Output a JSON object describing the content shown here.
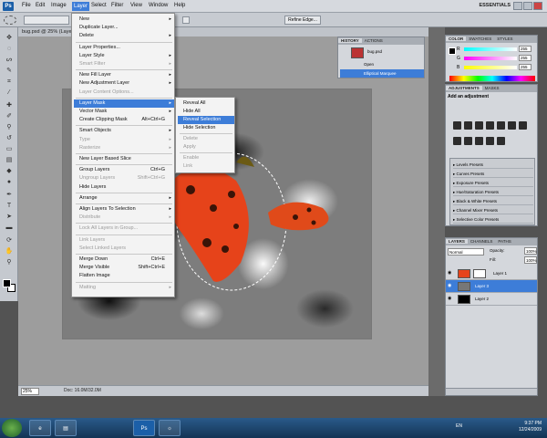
{
  "app": {
    "logo": "Ps",
    "workspace": "ESSENTIALS",
    "zoom_top": "25%"
  },
  "menubar": [
    "File",
    "Edit",
    "Image",
    "Layer",
    "Select",
    "Filter",
    "View",
    "Window",
    "Help"
  ],
  "options": {
    "refine_edge": "Refine Edge..."
  },
  "document": {
    "tab": "bug.psd @ 25% (Laye",
    "zoom": "25%",
    "info": "Doc: 16.0M/32.0M"
  },
  "history": {
    "tabs": [
      "HISTORY",
      "ACTIONS"
    ],
    "doc": "bug.psd",
    "items": [
      "Open",
      "Elliptical Marquee"
    ]
  },
  "color": {
    "tabs": [
      "COLOR",
      "SWATCHES",
      "STYLES"
    ],
    "r": "255",
    "g": "255",
    "b": "255",
    "labels": [
      "R",
      "G",
      "B"
    ]
  },
  "adjustments": {
    "tabs": [
      "ADJUSTMENTS",
      "MASKS"
    ],
    "title": "Add an adjustment",
    "presets": [
      "Levels Presets",
      "Curves Presets",
      "Exposure Presets",
      "Hue/Saturation Presets",
      "Black & White Presets",
      "Channel Mixer Presets",
      "Selective Color Presets"
    ]
  },
  "layers": {
    "tabs": [
      "LAYERS",
      "CHANNELS",
      "PATHS"
    ],
    "blend": "Normal",
    "opacity_label": "Opacity:",
    "opacity": "100%",
    "fill_label": "Fill:",
    "fill": "100%",
    "items": [
      "Layer 1",
      "Layer 3",
      "Layer 2"
    ]
  },
  "layer_menu": {
    "items": [
      {
        "label": "New",
        "shortcut": "",
        "arrow": "▸",
        "disabled": false
      },
      {
        "label": "Duplicate Layer...",
        "shortcut": "",
        "arrow": "",
        "disabled": false
      },
      {
        "label": "Delete",
        "shortcut": "",
        "arrow": "▸",
        "disabled": false
      },
      {
        "sep": true
      },
      {
        "label": "Layer Properties...",
        "shortcut": "",
        "arrow": "",
        "disabled": false
      },
      {
        "label": "Layer Style",
        "shortcut": "",
        "arrow": "▸",
        "disabled": false
      },
      {
        "label": "Smart Filter",
        "shortcut": "",
        "arrow": "▸",
        "disabled": true
      },
      {
        "sep": true
      },
      {
        "label": "New Fill Layer",
        "shortcut": "",
        "arrow": "▸",
        "disabled": false
      },
      {
        "label": "New Adjustment Layer",
        "shortcut": "",
        "arrow": "▸",
        "disabled": false
      },
      {
        "label": "Layer Content Options...",
        "shortcut": "",
        "arrow": "",
        "disabled": true
      },
      {
        "sep": true
      },
      {
        "label": "Layer Mask",
        "shortcut": "",
        "arrow": "▸",
        "disabled": false,
        "highlight": true
      },
      {
        "label": "Vector Mask",
        "shortcut": "",
        "arrow": "▸",
        "disabled": false
      },
      {
        "label": "Create Clipping Mask",
        "shortcut": "Alt+Ctrl+G",
        "arrow": "",
        "disabled": false
      },
      {
        "sep": true
      },
      {
        "label": "Smart Objects",
        "shortcut": "",
        "arrow": "▸",
        "disabled": false
      },
      {
        "label": "Type",
        "shortcut": "",
        "arrow": "▸",
        "disabled": true
      },
      {
        "label": "Rasterize",
        "shortcut": "",
        "arrow": "▸",
        "disabled": true
      },
      {
        "sep": true
      },
      {
        "label": "New Layer Based Slice",
        "shortcut": "",
        "arrow": "",
        "disabled": false
      },
      {
        "sep": true
      },
      {
        "label": "Group Layers",
        "shortcut": "Ctrl+G",
        "arrow": "",
        "disabled": false
      },
      {
        "label": "Ungroup Layers",
        "shortcut": "Shift+Ctrl+G",
        "arrow": "",
        "disabled": true
      },
      {
        "label": "Hide Layers",
        "shortcut": "",
        "arrow": "",
        "disabled": false
      },
      {
        "sep": true
      },
      {
        "label": "Arrange",
        "shortcut": "",
        "arrow": "▸",
        "disabled": false
      },
      {
        "sep": true
      },
      {
        "label": "Align Layers To Selection",
        "shortcut": "",
        "arrow": "▸",
        "disabled": false
      },
      {
        "label": "Distribute",
        "shortcut": "",
        "arrow": "▸",
        "disabled": true
      },
      {
        "sep": true
      },
      {
        "label": "Lock All Layers in Group...",
        "shortcut": "",
        "arrow": "",
        "disabled": true
      },
      {
        "sep": true
      },
      {
        "label": "Link Layers",
        "shortcut": "",
        "arrow": "",
        "disabled": true
      },
      {
        "label": "Select Linked Layers",
        "shortcut": "",
        "arrow": "",
        "disabled": true
      },
      {
        "sep": true
      },
      {
        "label": "Merge Down",
        "shortcut": "Ctrl+E",
        "arrow": "",
        "disabled": false
      },
      {
        "label": "Merge Visible",
        "shortcut": "Shift+Ctrl+E",
        "arrow": "",
        "disabled": false
      },
      {
        "label": "Flatten Image",
        "shortcut": "",
        "arrow": "",
        "disabled": false
      },
      {
        "sep": true
      },
      {
        "label": "Matting",
        "shortcut": "",
        "arrow": "▸",
        "disabled": true
      }
    ]
  },
  "mask_menu": {
    "items": [
      {
        "label": "Reveal All",
        "disabled": false
      },
      {
        "label": "Hide All",
        "disabled": false
      },
      {
        "label": "Reveal Selection",
        "disabled": false,
        "highlight": true
      },
      {
        "label": "Hide Selection",
        "disabled": false
      },
      {
        "sep": true
      },
      {
        "label": "Delete",
        "disabled": true
      },
      {
        "label": "Apply",
        "disabled": true
      },
      {
        "sep": true
      },
      {
        "label": "Enable",
        "disabled": true
      },
      {
        "label": "Link",
        "disabled": true
      }
    ]
  },
  "taskbar": {
    "lang": "EN",
    "time": "9:37 PM",
    "date": "12/24/2009",
    "apps": [
      "e",
      "▤",
      "Ps",
      "☼"
    ]
  }
}
